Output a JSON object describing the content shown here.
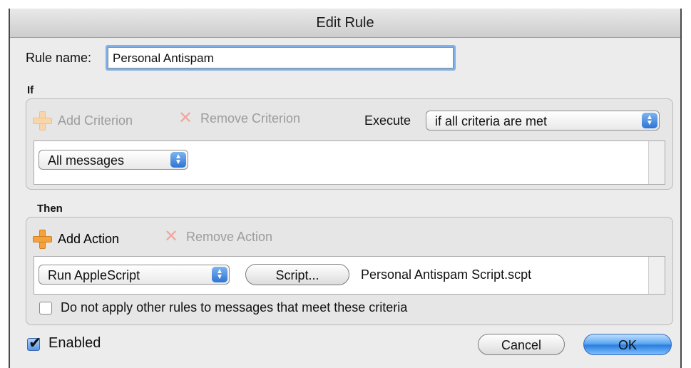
{
  "window": {
    "title": "Edit Rule"
  },
  "rule_name": {
    "label": "Rule name:",
    "value": "Personal Antispam"
  },
  "if_section": {
    "heading": "If",
    "add_label": "Add Criterion",
    "remove_label": "Remove Criterion",
    "execute_label": "Execute",
    "execute_value": "if all criteria are met",
    "criterion_value": "All messages"
  },
  "then_section": {
    "heading": "Then",
    "add_label": "Add Action",
    "remove_label": "Remove Action",
    "action_value": "Run AppleScript",
    "script_button": "Script...",
    "script_file": "Personal Antispam Script.scpt",
    "no_other_rules_label": "Do not apply other rules to messages that meet these criteria",
    "no_other_rules_checked": false
  },
  "footer": {
    "enabled_label": "Enabled",
    "enabled_checked": true,
    "cancel_label": "Cancel",
    "ok_label": "OK"
  }
}
